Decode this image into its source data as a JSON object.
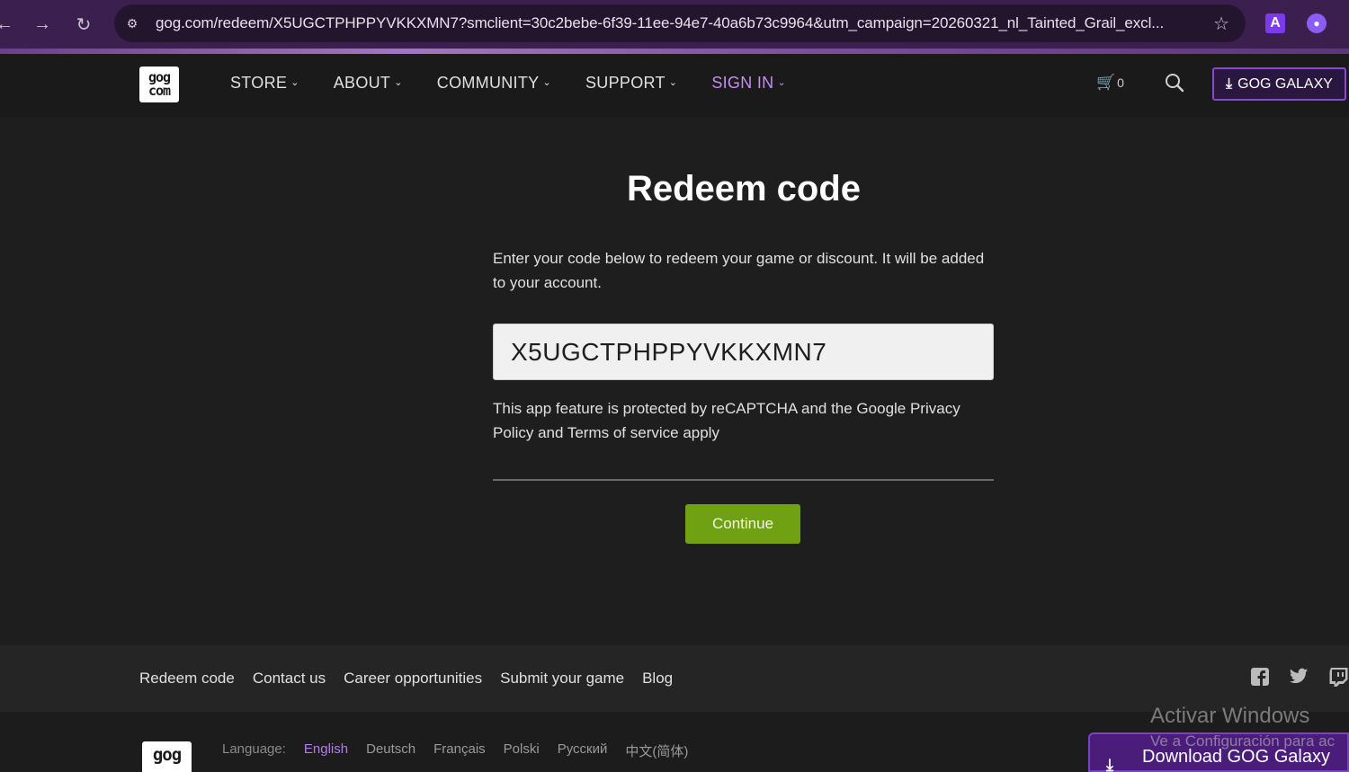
{
  "browser": {
    "url": "gog.com/redeem/X5UGCTPHPPYVKKXMN7?smclient=30c2bebe-6f39-11ee-94e7-40a6b73c9964&utm_campaign=20260321_nl_Tainted_Grail_excl...",
    "ext_a_label": "A"
  },
  "header": {
    "logo_top": "gog",
    "logo_bottom": "com",
    "nav": [
      "STORE",
      "ABOUT",
      "COMMUNITY",
      "SUPPORT",
      "SIGN IN"
    ],
    "cart_count": "0",
    "galaxy_button": "GOG GALAXY"
  },
  "main": {
    "title": "Redeem code",
    "intro": "Enter your code below to redeem your game or discount. It will be added to your account.",
    "code_value": "X5UGCTPHPPYVKKXMN7",
    "recaptcha": "This app feature is protected by reCAPTCHA and the Google Privacy Policy and Terms of service apply",
    "continue_label": "Continue"
  },
  "footer": {
    "links": [
      "Redeem code",
      "Contact us",
      "Career opportunities",
      "Submit your game",
      "Blog"
    ],
    "language_label": "Language:",
    "languages": [
      "English",
      "Deutsch",
      "Français",
      "Polski",
      "Русский",
      "中文(简体)"
    ],
    "logo_text": "gog"
  },
  "overlay": {
    "windows_title": "Activar Windows",
    "windows_sub": "Ve a Configuración para ac",
    "galaxy_popup": "Download GOG Galaxy"
  },
  "colors": {
    "accent_purple": "#c48ef0",
    "continue_green": "#6fa112"
  }
}
